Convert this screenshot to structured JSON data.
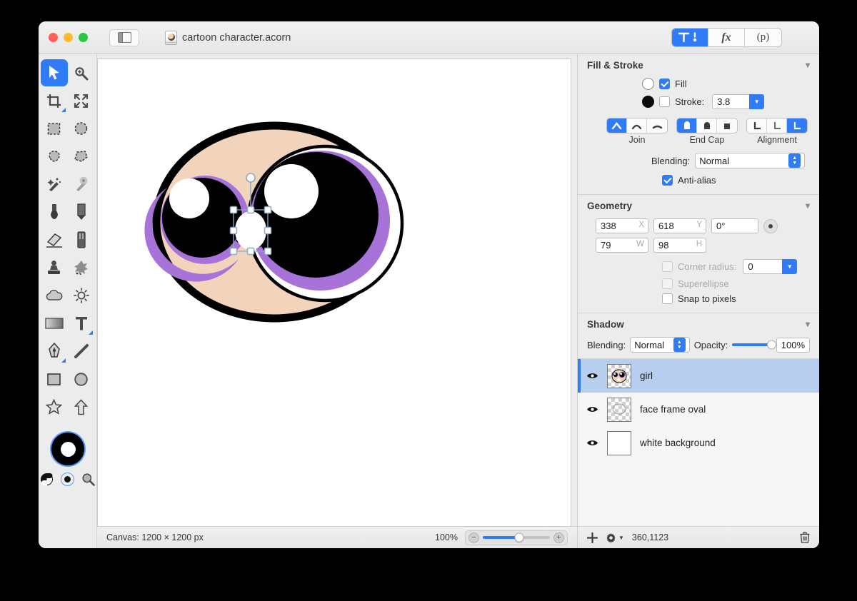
{
  "window": {
    "document_name": "cartoon character.acorn",
    "traffic_lights": [
      "close",
      "minimize",
      "zoom"
    ],
    "sidebar_toggle": "sidebar-toggle",
    "toolbar_segments": [
      {
        "id": "tools",
        "label": "",
        "icon": "hammer-tools-icon",
        "active": true
      },
      {
        "id": "effects",
        "label": "fx",
        "icon": "fx-icon",
        "active": false
      },
      {
        "id": "presets",
        "label": "(p)",
        "icon": "presets-icon",
        "active": false
      }
    ]
  },
  "tools": {
    "items": [
      {
        "name": "move-selection-tool",
        "icon": "arrow-cursor-icon",
        "selected": true,
        "badge": false
      },
      {
        "name": "zoom-tool",
        "icon": "magnifier-plus-icon",
        "selected": false,
        "badge": false
      },
      {
        "name": "crop-tool",
        "icon": "crop-icon",
        "selected": false,
        "badge": true
      },
      {
        "name": "transform-tool",
        "icon": "move-arrows-icon",
        "selected": false,
        "badge": false
      },
      {
        "name": "rectangular-select-tool",
        "icon": "marquee-rect-icon",
        "selected": false,
        "badge": false
      },
      {
        "name": "elliptical-select-tool",
        "icon": "marquee-ellipse-icon",
        "selected": false,
        "badge": false
      },
      {
        "name": "lasso-tool",
        "icon": "lasso-icon",
        "selected": false,
        "badge": false
      },
      {
        "name": "polygon-lasso-tool",
        "icon": "polygon-lasso-icon",
        "selected": false,
        "badge": false
      },
      {
        "name": "magic-wand-tool",
        "icon": "magic-wand-icon",
        "selected": false,
        "badge": false
      },
      {
        "name": "instant-alpha-tool",
        "icon": "instant-alpha-icon",
        "selected": false,
        "badge": false
      },
      {
        "name": "brush-tool",
        "icon": "brush-icon",
        "selected": false,
        "badge": false
      },
      {
        "name": "pencil-tool",
        "icon": "pencil-icon",
        "selected": false,
        "badge": false
      },
      {
        "name": "eraser-tool",
        "icon": "eraser-icon",
        "selected": false,
        "badge": false
      },
      {
        "name": "marker-tool",
        "icon": "marker-icon",
        "selected": false,
        "badge": false
      },
      {
        "name": "clone-stamp-tool",
        "icon": "clone-stamp-icon",
        "selected": false,
        "badge": false
      },
      {
        "name": "smudge-tool",
        "icon": "smudge-splatter-icon",
        "selected": false,
        "badge": false
      },
      {
        "name": "blur-tool",
        "icon": "cloud-blur-icon",
        "selected": false,
        "badge": false
      },
      {
        "name": "dodge-tool",
        "icon": "sun-dodge-icon",
        "selected": false,
        "badge": false
      },
      {
        "name": "gradient-tool",
        "icon": "gradient-icon",
        "selected": false,
        "badge": false
      },
      {
        "name": "text-tool",
        "icon": "text-t-icon",
        "selected": false,
        "badge": true
      },
      {
        "name": "pen-tool",
        "icon": "pen-nib-icon",
        "selected": false,
        "badge": true
      },
      {
        "name": "line-tool",
        "icon": "line-icon",
        "selected": false,
        "badge": false
      },
      {
        "name": "rectangle-tool",
        "icon": "rectangle-icon",
        "selected": false,
        "badge": false
      },
      {
        "name": "ellipse-tool",
        "icon": "ellipse-icon",
        "selected": false,
        "badge": false
      },
      {
        "name": "star-tool",
        "icon": "star-icon",
        "selected": false,
        "badge": false
      },
      {
        "name": "arrow-shape-tool",
        "icon": "arrow-up-shape-icon",
        "selected": false,
        "badge": false
      }
    ],
    "color_well": {
      "stroke_color": "#000000",
      "fill_color": "#ffffff",
      "focused": true
    },
    "mini_buttons": [
      {
        "name": "swap-colors-button",
        "icon": "yin-yang-swap-icon",
        "selected": false
      },
      {
        "name": "default-colors-button",
        "icon": "default-colors-icon",
        "selected": true
      },
      {
        "name": "loupe-button",
        "icon": "magnifier-icon",
        "selected": false
      }
    ]
  },
  "inspector": {
    "fill_stroke": {
      "title": "Fill & Stroke",
      "collapse_icon": "chevron-down-icon",
      "fill": {
        "label": "Fill",
        "checked": true,
        "swatch_color": "#ffffff"
      },
      "stroke": {
        "label": "Stroke:",
        "checked": false,
        "swatch_color": "#0b0b0b",
        "width": "3.8"
      },
      "join": {
        "label": "Join",
        "options": [
          "miter-join-icon",
          "round-join-icon",
          "bevel-join-icon"
        ],
        "selected_index": 0
      },
      "end_cap": {
        "label": "End Cap",
        "options": [
          "butt-cap-icon",
          "round-cap-icon",
          "square-cap-icon"
        ],
        "selected_index": 0
      },
      "alignment": {
        "label": "Alignment",
        "options": [
          "align-inside-icon",
          "align-center-icon",
          "align-outside-icon"
        ],
        "selected_index": 2
      },
      "blending": {
        "label": "Blending:",
        "value": "Normal"
      },
      "anti_alias": {
        "label": "Anti-alias",
        "checked": true
      }
    },
    "geometry": {
      "title": "Geometry",
      "collapse_icon": "chevron-down-icon",
      "x": {
        "value": "338",
        "suffix": "X"
      },
      "y": {
        "value": "618",
        "suffix": "Y"
      },
      "rotation": {
        "value": "0°"
      },
      "w": {
        "value": "79",
        "suffix": "W"
      },
      "h": {
        "value": "98",
        "suffix": "H"
      },
      "corner_radius": {
        "label": "Corner radius:",
        "checked": false,
        "enabled": false,
        "value": "0"
      },
      "superellipse": {
        "label": "Superellipse",
        "checked": false,
        "enabled": false
      },
      "snap_to_pixels": {
        "label": "Snap to pixels",
        "checked": false,
        "enabled": true
      }
    },
    "shadow": {
      "title": "Shadow",
      "collapse_icon": "chevron-down-icon",
      "blending": {
        "label": "Blending:",
        "value": "Normal"
      },
      "opacity": {
        "label": "Opacity:",
        "value": "100%",
        "percent": 100
      }
    },
    "layers": [
      {
        "name": "girl",
        "visible": true,
        "selected": true,
        "thumb": "character-face"
      },
      {
        "name": "face frame oval",
        "visible": true,
        "selected": false,
        "thumb": "oval-outline"
      },
      {
        "name": "white background",
        "visible": true,
        "selected": false,
        "thumb": "white"
      }
    ],
    "layer_bar": {
      "add_icon": "plus-icon",
      "settings_icon": "gear-dropdown-icon",
      "coordinates": "360,1123",
      "delete_icon": "trash-icon"
    }
  },
  "status_bar": {
    "canvas_info": "Canvas: 1200 × 1200 px",
    "zoom_level": "100%",
    "zoom_out_icon": "minus-circle-icon",
    "zoom_in_icon": "plus-circle-icon",
    "zoom_percent": 54
  },
  "artwork": {
    "face_color": "#f2d4bc",
    "outline_color": "#000000",
    "iris_purple": "#a873d8",
    "eye_white": "#ffffff",
    "selection_color": "#8fa8c8",
    "selected_shape": "nose-oval"
  }
}
